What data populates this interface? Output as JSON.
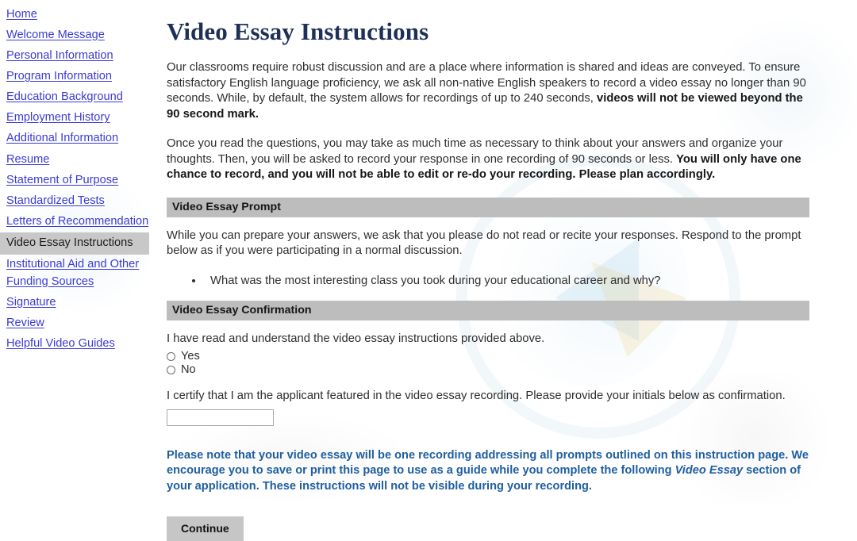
{
  "sidebar": {
    "items": [
      {
        "label": "Home",
        "active": false
      },
      {
        "label": "Welcome Message",
        "active": false
      },
      {
        "label": "Personal Information",
        "active": false
      },
      {
        "label": "Program Information",
        "active": false
      },
      {
        "label": "Education Background",
        "active": false
      },
      {
        "label": "Employment History",
        "active": false
      },
      {
        "label": "Additional Information",
        "active": false
      },
      {
        "label": "Resume",
        "active": false
      },
      {
        "label": "Statement of Purpose",
        "active": false
      },
      {
        "label": "Standardized Tests",
        "active": false
      },
      {
        "label": "Letters of Recommendation",
        "active": false
      },
      {
        "label": "Video Essay Instructions",
        "active": true
      },
      {
        "label": "Institutional Aid and Other Funding Sources",
        "active": false
      },
      {
        "label": "Signature",
        "active": false
      },
      {
        "label": "Review",
        "active": false
      },
      {
        "label": "Helpful Video Guides",
        "active": false
      }
    ]
  },
  "main": {
    "title": "Video Essay Instructions",
    "paragraph1": {
      "normal_1": "Our classrooms require robust discussion and are a place where information is shared and ideas are conveyed. To ensure satisfactory English language proficiency, we ask all non-native English speakers to record a video essay no longer than 90 seconds. While, by default, the system allows for recordings of up to 240 seconds, ",
      "bold_1": "videos will not be viewed beyond the 90 second mark."
    },
    "paragraph2": {
      "normal_1": "Once you read the questions, you may take as much time as necessary to think about your answers and organize your thoughts. Then, you will be asked to record your response in one recording of 90 seconds or less. ",
      "bold_1": "You will only have one chance to record, and you will not be able to edit or re-do your recording. Please plan accordingly."
    },
    "prompt_section": {
      "header": "Video Essay Prompt",
      "intro": "While you can prepare your answers, we ask that you please do not read or recite your responses. Respond to the prompt below as if you were participating in a normal discussion.",
      "bullets": [
        "What was the most interesting class you took during your educational career and why?"
      ]
    },
    "confirmation_section": {
      "header": "Video Essay Confirmation",
      "question": "I have read and understand the video essay instructions provided above.",
      "options": [
        {
          "label": "Yes",
          "selected": false
        },
        {
          "label": "No",
          "selected": false
        }
      ],
      "certify_text": "I certify that I am the applicant featured in the video essay recording. Please provide your initials below as confirmation.",
      "initials_value": "",
      "initials_placeholder": ""
    },
    "note": {
      "part1": "Please note that your video essay will be one recording addressing all prompts outlined on this instruction page. We encourage you to save or print this page to use as a guide while you complete the following ",
      "italic": "Video Essay",
      "part2": " section of your application. These instructions will not be visible during your recording."
    },
    "continue_label": "Continue"
  },
  "colors": {
    "link": "#3b3bd4",
    "title": "#1d3057",
    "section_bar": "#bdbdbd",
    "note": "#1f5fa0",
    "button": "#c6c6c6",
    "active_nav_bg": "#c8c8c8"
  }
}
